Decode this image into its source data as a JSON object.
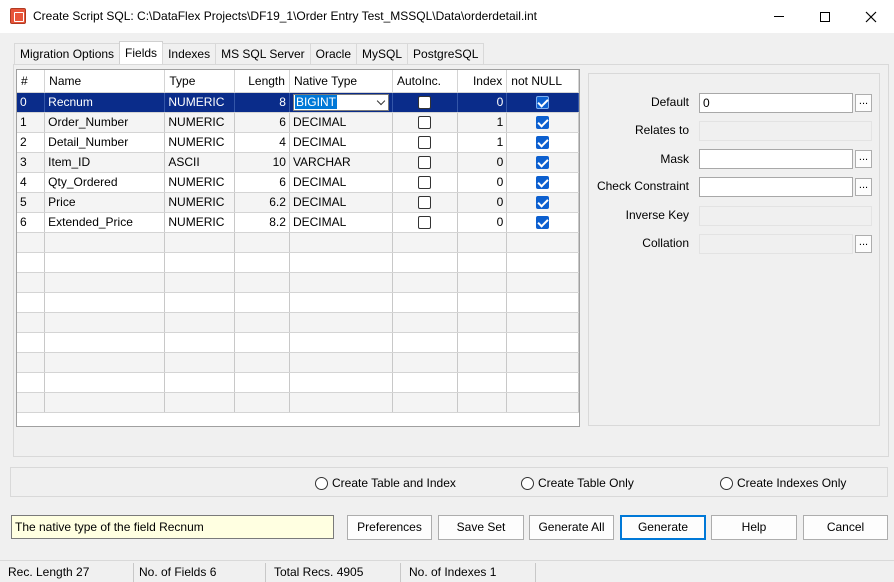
{
  "window": {
    "title": "Create Script SQL: C:\\DataFlex Projects\\DF19_1\\Order Entry Test_MSSQL\\Data\\orderdetail.int"
  },
  "tabs": [
    "Migration Options",
    "Fields",
    "Indexes",
    "MS SQL Server",
    "Oracle",
    "MySQL",
    "PostgreSQL"
  ],
  "grid": {
    "columns": [
      "#",
      "Name",
      "Type",
      "Length",
      "Native Type",
      "AutoInc.",
      "Index",
      "not NULL"
    ],
    "rows": [
      {
        "num": "0",
        "name": "Recnum",
        "type": "NUMERIC",
        "length": "8",
        "native": "BIGINT",
        "autoinc": false,
        "index": "0",
        "notnull": true
      },
      {
        "num": "1",
        "name": "Order_Number",
        "type": "NUMERIC",
        "length": "6",
        "native": "DECIMAL",
        "autoinc": false,
        "index": "1",
        "notnull": true
      },
      {
        "num": "2",
        "name": "Detail_Number",
        "type": "NUMERIC",
        "length": "4",
        "native": "DECIMAL",
        "autoinc": false,
        "index": "1",
        "notnull": true
      },
      {
        "num": "3",
        "name": "Item_ID",
        "type": "ASCII",
        "length": "10",
        "native": "VARCHAR",
        "autoinc": false,
        "index": "0",
        "notnull": true
      },
      {
        "num": "4",
        "name": "Qty_Ordered",
        "type": "NUMERIC",
        "length": "6",
        "native": "DECIMAL",
        "autoinc": false,
        "index": "0",
        "notnull": true
      },
      {
        "num": "5",
        "name": "Price",
        "type": "NUMERIC",
        "length": "6.2",
        "native": "DECIMAL",
        "autoinc": false,
        "index": "0",
        "notnull": true
      },
      {
        "num": "6",
        "name": "Extended_Price",
        "type": "NUMERIC",
        "length": "8.2",
        "native": "DECIMAL",
        "autoinc": false,
        "index": "0",
        "notnull": true
      }
    ]
  },
  "properties": {
    "default_label": "Default",
    "default_value": "0",
    "relates_label": "Relates to",
    "mask_label": "Mask",
    "check_label": "Check Constraint",
    "inverse_label": "Inverse Key",
    "collation_label": "Collation",
    "dots": "..."
  },
  "options": {
    "create_table_and_index": "Create Table and Index",
    "create_table_only": "Create Table Only",
    "create_indexes_only": "Create Indexes Only"
  },
  "hint": "The native type of the field Recnum",
  "buttons": {
    "preferences": "Preferences",
    "save_set": "Save Set",
    "generate_all": "Generate All",
    "generate": "Generate",
    "help": "Help",
    "cancel": "Cancel"
  },
  "status": {
    "rec_length": "Rec. Length 27",
    "num_fields": "No. of Fields 6",
    "total_recs": "Total Recs. 4905",
    "num_indexes": "No. of Indexes 1"
  },
  "colors": {
    "selection": "#0a2c8a",
    "checkbox": "#0c5fcf",
    "hint_bg": "#ffffe1"
  }
}
